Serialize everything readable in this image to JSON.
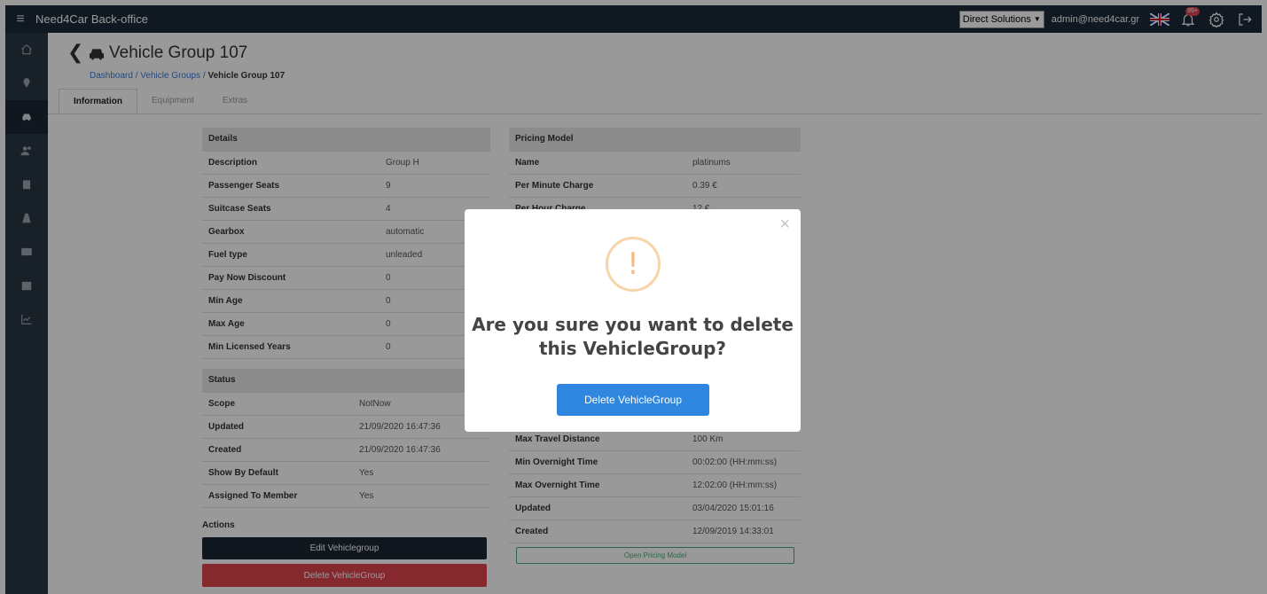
{
  "app": {
    "title": "Need4Car Back-office",
    "company_select": "Direct Solutions",
    "user_email": "admin@need4car.gr",
    "notification_count": "99+"
  },
  "page": {
    "title": "Vehicle Group 107",
    "breadcrumb": [
      "Dashboard",
      "Vehicle Groups",
      "Vehicle Group 107"
    ],
    "tabs": [
      "Information",
      "Equipment",
      "Extras"
    ]
  },
  "details": {
    "header": "Details",
    "rows": [
      {
        "label": "Description",
        "value": "Group H"
      },
      {
        "label": "Passenger Seats",
        "value": "9"
      },
      {
        "label": "Suitcase Seats",
        "value": "4"
      },
      {
        "label": "Gearbox",
        "value": "automatic"
      },
      {
        "label": "Fuel type",
        "value": "unleaded"
      },
      {
        "label": "Pay Now Discount",
        "value": "0"
      },
      {
        "label": "Min Age",
        "value": "0"
      },
      {
        "label": "Max Age",
        "value": "0"
      },
      {
        "label": "Min Licensed Years",
        "value": "0"
      }
    ]
  },
  "status": {
    "header": "Status",
    "rows": [
      {
        "label": "Scope",
        "value": "NotNow"
      },
      {
        "label": "Updated",
        "value": "21/09/2020 16:47:36"
      },
      {
        "label": "Created",
        "value": "21/09/2020 16:47:36"
      },
      {
        "label": "Show By Default",
        "value": "Yes"
      },
      {
        "label": "Assigned To Member",
        "value": "Yes"
      }
    ]
  },
  "actions": {
    "label": "Actions",
    "edit_label": "Edit Vehiclegroup",
    "delete_label": "Delete VehicleGroup"
  },
  "pricing": {
    "header": "Pricing Model",
    "rows": [
      {
        "label": "Name",
        "value": "platinums"
      },
      {
        "label": "Per Minute Charge",
        "value": "0.39 €"
      },
      {
        "label": "Per Hour Charge",
        "value": "12 €"
      },
      {
        "label": "",
        "value": ""
      },
      {
        "label": "",
        "value": ""
      },
      {
        "label": "",
        "value": ""
      },
      {
        "label": "",
        "value": ""
      },
      {
        "label": "",
        "value": ""
      },
      {
        "label": "",
        "value": ""
      },
      {
        "label": "",
        "value": ""
      },
      {
        "label": "",
        "value": ""
      },
      {
        "label": "",
        "value": ""
      },
      {
        "label": "Max Travel Distance",
        "value": "100 Km"
      },
      {
        "label": "Min Overnight Time",
        "value": "00:02:00 (HH:mm:ss)"
      },
      {
        "label": "Max Overnight Time",
        "value": "12:02:00 (HH:mm:ss)"
      },
      {
        "label": "Updated",
        "value": "03/04/2020 15:01:16"
      },
      {
        "label": "Created",
        "value": "12/09/2019 14:33:01"
      }
    ],
    "open_label": "Open Pricing Model"
  },
  "modal": {
    "icon": "!",
    "title": "Are you sure you want to delete this VehicleGroup?",
    "confirm_label": "Delete VehicleGroup",
    "close": "×"
  },
  "colors": {
    "topbar": "#1c2a38",
    "sidebar": "#2a3744",
    "delete": "#e0454f",
    "primary": "#2e86de",
    "warning": "#f6bb85",
    "success": "#4aaa75"
  }
}
